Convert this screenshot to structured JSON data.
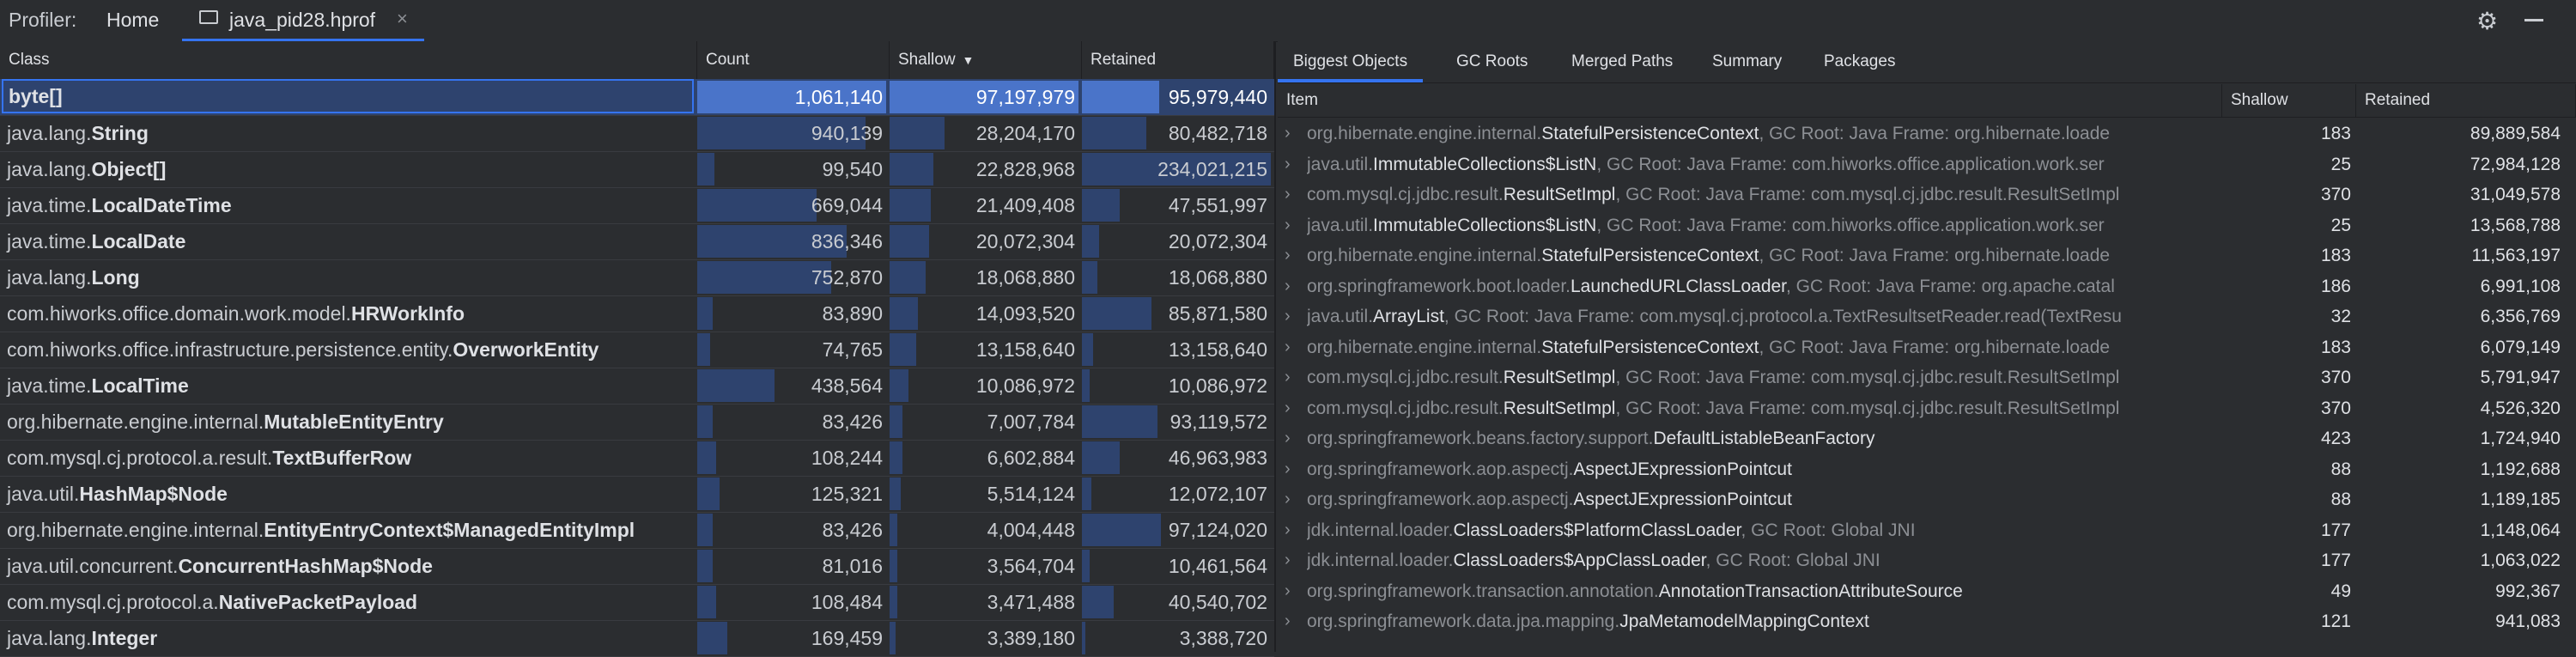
{
  "topbar": {
    "profiler_label": "Profiler:",
    "home_tab": "Home",
    "file_tab": "java_pid28.hprof",
    "close_glyph": "×",
    "settings_icon": "gear-icon",
    "minimize_icon": "minimize-icon"
  },
  "class_table": {
    "columns": {
      "class": "Class",
      "count": "Count",
      "shallow": "Shallow",
      "retained": "Retained"
    },
    "sort_indicator": "▼",
    "bar_color": "#2e436e",
    "selected_color": "#4a74c9",
    "rows": [
      {
        "pkg": "",
        "name": "byte[]",
        "count": "1,061,140",
        "shallow": "97,197,979",
        "retained": "95,979,440",
        "count_frac": 1.0,
        "shallow_frac": 1.0,
        "retained_frac": 0.41
      },
      {
        "pkg": "java.lang.",
        "name": "String",
        "count": "940,139",
        "shallow": "28,204,170",
        "retained": "80,482,718",
        "count_frac": 0.89,
        "shallow_frac": 0.29,
        "retained_frac": 0.34
      },
      {
        "pkg": "java.lang.",
        "name": "Object[]",
        "count": "99,540",
        "shallow": "22,828,968",
        "retained": "234,021,215",
        "count_frac": 0.09,
        "shallow_frac": 0.23,
        "retained_frac": 1.0
      },
      {
        "pkg": "java.time.",
        "name": "LocalDateTime",
        "count": "669,044",
        "shallow": "21,409,408",
        "retained": "47,551,997",
        "count_frac": 0.63,
        "shallow_frac": 0.22,
        "retained_frac": 0.2
      },
      {
        "pkg": "java.time.",
        "name": "LocalDate",
        "count": "836,346",
        "shallow": "20,072,304",
        "retained": "20,072,304",
        "count_frac": 0.79,
        "shallow_frac": 0.21,
        "retained_frac": 0.09
      },
      {
        "pkg": "java.lang.",
        "name": "Long",
        "count": "752,870",
        "shallow": "18,068,880",
        "retained": "18,068,880",
        "count_frac": 0.71,
        "shallow_frac": 0.19,
        "retained_frac": 0.08
      },
      {
        "pkg": "com.hiworks.office.domain.work.model.",
        "name": "HRWorkInfo",
        "count": "83,890",
        "shallow": "14,093,520",
        "retained": "85,871,580",
        "count_frac": 0.08,
        "shallow_frac": 0.15,
        "retained_frac": 0.37
      },
      {
        "pkg": "com.hiworks.office.infrastructure.persistence.entity.",
        "name": "OverworkEntity",
        "count": "74,765",
        "shallow": "13,158,640",
        "retained": "13,158,640",
        "count_frac": 0.07,
        "shallow_frac": 0.14,
        "retained_frac": 0.06
      },
      {
        "pkg": "java.time.",
        "name": "LocalTime",
        "count": "438,564",
        "shallow": "10,086,972",
        "retained": "10,086,972",
        "count_frac": 0.41,
        "shallow_frac": 0.1,
        "retained_frac": 0.04
      },
      {
        "pkg": "org.hibernate.engine.internal.",
        "name": "MutableEntityEntry",
        "count": "83,426",
        "shallow": "7,007,784",
        "retained": "93,119,572",
        "count_frac": 0.08,
        "shallow_frac": 0.07,
        "retained_frac": 0.4
      },
      {
        "pkg": "com.mysql.cj.protocol.a.result.",
        "name": "TextBufferRow",
        "count": "108,244",
        "shallow": "6,602,884",
        "retained": "46,963,983",
        "count_frac": 0.1,
        "shallow_frac": 0.07,
        "retained_frac": 0.2
      },
      {
        "pkg": "java.util.",
        "name": "HashMap$Node",
        "count": "125,321",
        "shallow": "5,514,124",
        "retained": "12,072,107",
        "count_frac": 0.12,
        "shallow_frac": 0.06,
        "retained_frac": 0.05
      },
      {
        "pkg": "org.hibernate.engine.internal.",
        "name": "EntityEntryContext$ManagedEntityImpl",
        "count": "83,426",
        "shallow": "4,004,448",
        "retained": "97,124,020",
        "count_frac": 0.08,
        "shallow_frac": 0.04,
        "retained_frac": 0.42
      },
      {
        "pkg": "java.util.concurrent.",
        "name": "ConcurrentHashMap$Node",
        "count": "81,016",
        "shallow": "3,564,704",
        "retained": "10,461,564",
        "count_frac": 0.08,
        "shallow_frac": 0.04,
        "retained_frac": 0.04
      },
      {
        "pkg": "com.mysql.cj.protocol.a.",
        "name": "NativePacketPayload",
        "count": "108,484",
        "shallow": "3,471,488",
        "retained": "40,540,702",
        "count_frac": 0.1,
        "shallow_frac": 0.04,
        "retained_frac": 0.17
      },
      {
        "pkg": "java.lang.",
        "name": "Integer",
        "count": "169,459",
        "shallow": "3,389,180",
        "retained": "3,388,720",
        "count_frac": 0.16,
        "shallow_frac": 0.03,
        "retained_frac": 0.01
      }
    ]
  },
  "detail_panel": {
    "tabs": [
      "Biggest Objects",
      "GC Roots",
      "Merged Paths",
      "Summary",
      "Packages"
    ],
    "active_tab": "Biggest Objects",
    "columns": {
      "item": "Item",
      "shallow": "Shallow",
      "retained": "Retained"
    },
    "chevron": "›",
    "rows": [
      {
        "pkg": "org.hibernate.engine.internal.",
        "name": "StatefulPersistenceContext",
        "gc": ", GC Root: Java Frame: org.hibernate.loade",
        "shallow": "183",
        "retained": "89,889,584"
      },
      {
        "pkg": "java.util.",
        "name": "ImmutableCollections$ListN",
        "gc": ", GC Root: Java Frame: com.hiworks.office.application.work.ser",
        "shallow": "25",
        "retained": "72,984,128"
      },
      {
        "pkg": "com.mysql.cj.jdbc.result.",
        "name": "ResultSetImpl",
        "gc": ", GC Root: Java Frame: com.mysql.cj.jdbc.result.ResultSetImpl",
        "shallow": "370",
        "retained": "31,049,578"
      },
      {
        "pkg": "java.util.",
        "name": "ImmutableCollections$ListN",
        "gc": ", GC Root: Java Frame: com.hiworks.office.application.work.ser",
        "shallow": "25",
        "retained": "13,568,788"
      },
      {
        "pkg": "org.hibernate.engine.internal.",
        "name": "StatefulPersistenceContext",
        "gc": ", GC Root: Java Frame: org.hibernate.loade",
        "shallow": "183",
        "retained": "11,563,197"
      },
      {
        "pkg": "org.springframework.boot.loader.",
        "name": "LaunchedURLClassLoader",
        "gc": ", GC Root: Java Frame: org.apache.catal",
        "shallow": "186",
        "retained": "6,991,108"
      },
      {
        "pkg": "java.util.",
        "name": "ArrayList",
        "gc": ", GC Root: Java Frame: com.mysql.cj.protocol.a.TextResultsetReader.read(TextResu",
        "shallow": "32",
        "retained": "6,356,769"
      },
      {
        "pkg": "org.hibernate.engine.internal.",
        "name": "StatefulPersistenceContext",
        "gc": ", GC Root: Java Frame: org.hibernate.loade",
        "shallow": "183",
        "retained": "6,079,149"
      },
      {
        "pkg": "com.mysql.cj.jdbc.result.",
        "name": "ResultSetImpl",
        "gc": ", GC Root: Java Frame: com.mysql.cj.jdbc.result.ResultSetImpl",
        "shallow": "370",
        "retained": "5,791,947"
      },
      {
        "pkg": "com.mysql.cj.jdbc.result.",
        "name": "ResultSetImpl",
        "gc": ", GC Root: Java Frame: com.mysql.cj.jdbc.result.ResultSetImpl",
        "shallow": "370",
        "retained": "4,526,320"
      },
      {
        "pkg": "org.springframework.beans.factory.support.",
        "name": "DefaultListableBeanFactory",
        "gc": "",
        "shallow": "423",
        "retained": "1,724,940"
      },
      {
        "pkg": "org.springframework.aop.aspectj.",
        "name": "AspectJExpressionPointcut",
        "gc": "",
        "shallow": "88",
        "retained": "1,192,688"
      },
      {
        "pkg": "org.springframework.aop.aspectj.",
        "name": "AspectJExpressionPointcut",
        "gc": "",
        "shallow": "88",
        "retained": "1,189,185"
      },
      {
        "pkg": "jdk.internal.loader.",
        "name": "ClassLoaders$PlatformClassLoader",
        "gc": ", GC Root: Global JNI",
        "shallow": "177",
        "retained": "1,148,064"
      },
      {
        "pkg": "jdk.internal.loader.",
        "name": "ClassLoaders$AppClassLoader",
        "gc": ", GC Root: Global JNI",
        "shallow": "177",
        "retained": "1,063,022"
      },
      {
        "pkg": "org.springframework.transaction.annotation.",
        "name": "AnnotationTransactionAttributeSource",
        "gc": "",
        "shallow": "49",
        "retained": "992,367"
      },
      {
        "pkg": "org.springframework.data.jpa.mapping.",
        "name": "JpaMetamodelMappingContext",
        "gc": "",
        "shallow": "121",
        "retained": "941,083"
      }
    ]
  }
}
